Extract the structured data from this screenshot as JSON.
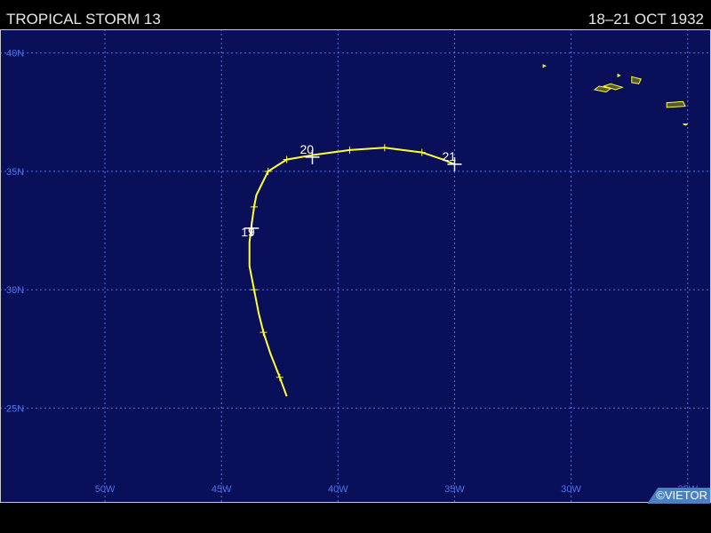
{
  "header": {
    "title": "TROPICAL STORM 13",
    "dates": "18–21 OCT 1932"
  },
  "credit": "©VIETOR",
  "map": {
    "background_color": "#0a0f5a",
    "grid_color": "#4d74e8",
    "track_color": "#ffff33",
    "land_color": "#5a5a2a",
    "land_outline_color": "#ffff33",
    "lon_range": [
      -54.5,
      -24.0
    ],
    "lat_range": [
      21.0,
      41.0
    ],
    "grid_lines": "dotted",
    "lon_labels": [
      {
        "lon": -50,
        "text": "50W"
      },
      {
        "lon": -45,
        "text": "45W"
      },
      {
        "lon": -40,
        "text": "40W"
      },
      {
        "lon": -35,
        "text": "35W"
      },
      {
        "lon": -30,
        "text": "30W"
      },
      {
        "lon": -25,
        "text": "25W"
      }
    ],
    "lat_labels": [
      {
        "lat": 40,
        "text": "40N"
      },
      {
        "lat": 35,
        "text": "35N"
      },
      {
        "lat": 30,
        "text": "30N"
      },
      {
        "lat": 25,
        "text": "25N"
      }
    ],
    "track": [
      {
        "lon": -42.2,
        "lat": 25.5
      },
      {
        "lon": -42.5,
        "lat": 26.3
      },
      {
        "lon": -42.9,
        "lat": 27.3
      },
      {
        "lon": -43.2,
        "lat": 28.2
      },
      {
        "lon": -43.4,
        "lat": 29.0
      },
      {
        "lon": -43.6,
        "lat": 30.0
      },
      {
        "lon": -43.8,
        "lat": 31.0
      },
      {
        "lon": -43.8,
        "lat": 32.0
      },
      {
        "lon": -43.7,
        "lat": 32.8
      },
      {
        "lon": -43.6,
        "lat": 33.5
      },
      {
        "lon": -43.5,
        "lat": 34.0
      },
      {
        "lon": -43.0,
        "lat": 35.0
      },
      {
        "lon": -42.2,
        "lat": 35.5
      },
      {
        "lon": -41.0,
        "lat": 35.7
      },
      {
        "lon": -39.5,
        "lat": 35.9
      },
      {
        "lon": -38.0,
        "lat": 36.0
      },
      {
        "lon": -36.4,
        "lat": 35.8
      },
      {
        "lon": -35.5,
        "lat": 35.5
      },
      {
        "lon": -35.0,
        "lat": 35.3
      }
    ],
    "six_hour_ticks": [
      {
        "lon": -42.5,
        "lat": 26.3
      },
      {
        "lon": -43.2,
        "lat": 28.2
      },
      {
        "lon": -43.6,
        "lat": 30.0
      },
      {
        "lon": -43.6,
        "lat": 33.5
      },
      {
        "lon": -43.0,
        "lat": 35.0
      },
      {
        "lon": -42.2,
        "lat": 35.5
      },
      {
        "lon": -39.5,
        "lat": 35.9
      },
      {
        "lon": -38.0,
        "lat": 36.0
      },
      {
        "lon": -36.4,
        "lat": 35.8
      }
    ],
    "day_markers": [
      {
        "lon": -43.7,
        "lat": 32.6,
        "label": "19"
      },
      {
        "lon": -41.1,
        "lat": 35.6,
        "label": "20"
      },
      {
        "lon": -35.0,
        "lat": 35.3,
        "label": "21"
      }
    ],
    "islands": [
      {
        "name": "flores",
        "points": [
          [
            -31.2,
            39.5
          ],
          [
            -31.1,
            39.45
          ],
          [
            -31.2,
            39.4
          ]
        ]
      },
      {
        "name": "graciosa",
        "points": [
          [
            -28.0,
            39.1
          ],
          [
            -27.9,
            39.05
          ],
          [
            -28.0,
            39.0
          ]
        ]
      },
      {
        "name": "sao-jorge",
        "points": [
          [
            -28.3,
            38.7
          ],
          [
            -27.8,
            38.55
          ],
          [
            -28.1,
            38.45
          ],
          [
            -28.6,
            38.6
          ]
        ]
      },
      {
        "name": "pico",
        "points": [
          [
            -28.8,
            38.6
          ],
          [
            -28.3,
            38.5
          ],
          [
            -28.5,
            38.35
          ],
          [
            -29.0,
            38.45
          ]
        ]
      },
      {
        "name": "terceira",
        "points": [
          [
            -27.4,
            39.0
          ],
          [
            -27.0,
            38.9
          ],
          [
            -27.1,
            38.7
          ],
          [
            -27.4,
            38.75
          ]
        ]
      },
      {
        "name": "sao-miguel",
        "points": [
          [
            -25.9,
            37.9
          ],
          [
            -25.2,
            37.95
          ],
          [
            -25.1,
            37.75
          ],
          [
            -25.9,
            37.7
          ]
        ]
      },
      {
        "name": "santa-maria",
        "points": [
          [
            -25.2,
            37.0
          ],
          [
            -25.0,
            37.0
          ],
          [
            -25.1,
            36.95
          ]
        ]
      }
    ]
  }
}
